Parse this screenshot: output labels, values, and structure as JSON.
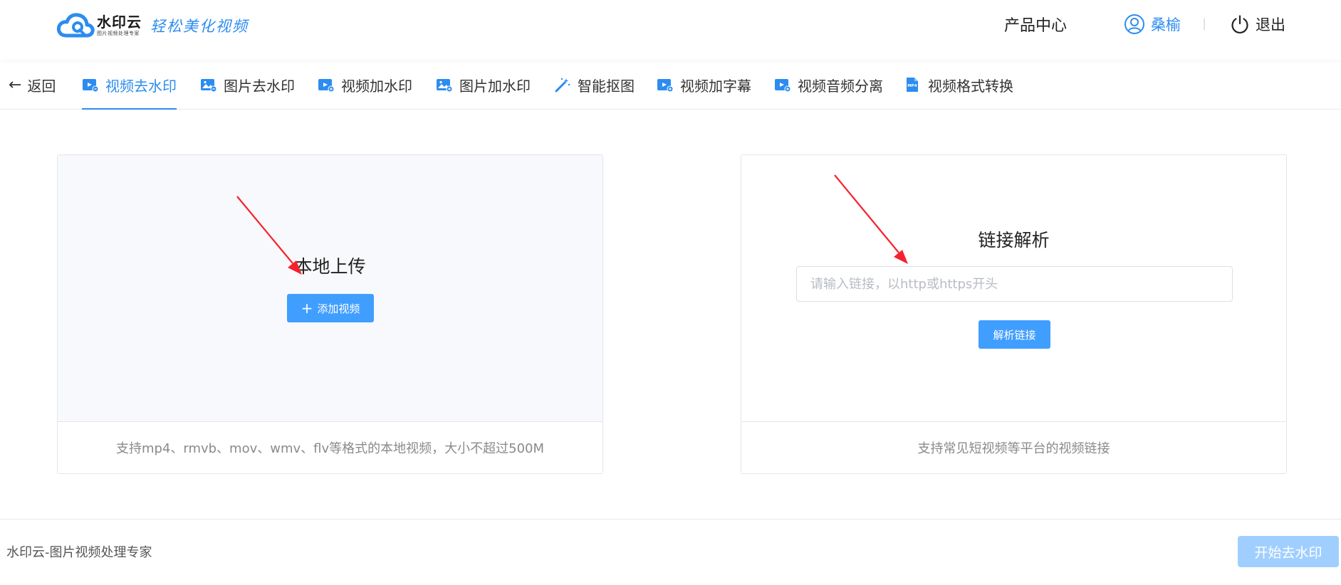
{
  "header": {
    "logo_name": "水印云",
    "logo_sub": "图片视频处理专家",
    "slogan": "轻松美化视频",
    "product_center": "产品中心",
    "username": "桑榆",
    "logout": "退出"
  },
  "tabs": {
    "back": "返回",
    "items": [
      {
        "label": "视频去水印",
        "icon": "video-remove-watermark-icon",
        "active": true
      },
      {
        "label": "图片去水印",
        "icon": "image-remove-watermark-icon"
      },
      {
        "label": "视频加水印",
        "icon": "video-add-watermark-icon"
      },
      {
        "label": "图片加水印",
        "icon": "image-add-watermark-icon"
      },
      {
        "label": "智能抠图",
        "icon": "magic-wand-icon"
      },
      {
        "label": "视频加字幕",
        "icon": "video-subtitle-icon"
      },
      {
        "label": "视频音频分离",
        "icon": "audio-separate-icon"
      },
      {
        "label": "视频格式转换",
        "icon": "mp4-file-icon"
      }
    ]
  },
  "upload_panel": {
    "title": "本地上传",
    "button": "添加视频",
    "hint": "支持mp4、rmvb、mov、wmv、flv等格式的本地视频，大小不超过500M"
  },
  "link_panel": {
    "title": "链接解析",
    "placeholder": "请输入链接，以http或https开头",
    "value": "",
    "button": "解析链接",
    "hint": "支持常见短视频等平台的视频链接"
  },
  "footer": {
    "text": "水印云-图片视频处理专家",
    "start_button": "开始去水印"
  },
  "colors": {
    "accent": "#2c8cf0",
    "button": "#409eff",
    "button_disabled": "#a0cfff",
    "annotation_arrow": "#f5222d"
  }
}
